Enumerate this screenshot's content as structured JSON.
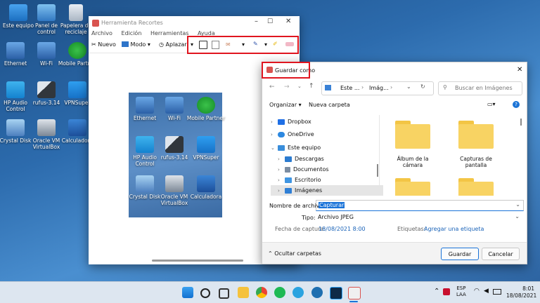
{
  "desktop": {
    "icons": [
      {
        "label": "Este equipo"
      },
      {
        "label": "Panel de control"
      },
      {
        "label": "Papelera de reciclaje"
      },
      {
        "label": "Ethernet"
      },
      {
        "label": "Wi-Fi"
      },
      {
        "label": "Mobile Partner"
      },
      {
        "label": "HP Audio Control"
      },
      {
        "label": "rufus-3.14"
      },
      {
        "label": "VPNSuper"
      },
      {
        "label": "Crystal Disk"
      },
      {
        "label": "Oracle VM VirtualBox"
      },
      {
        "label": "Calculadora"
      }
    ]
  },
  "snipping": {
    "title": "Herramienta Recortes",
    "menu": [
      "Archivo",
      "Edición",
      "Herramientas",
      "Ayuda"
    ],
    "toolbar": {
      "new": "Nuevo",
      "mode": "Modo",
      "delay": "Aplazar"
    },
    "capture_icons": [
      {
        "label": "Ethernet"
      },
      {
        "label": "Wi-Fi"
      },
      {
        "label": "Mobile Partner"
      },
      {
        "label": "HP Audio Control"
      },
      {
        "label": "rufus-3.14"
      },
      {
        "label": "VPNSuper"
      },
      {
        "label": "Crystal Disk"
      },
      {
        "label": "Oracle VM VirtualBox"
      },
      {
        "label": "Calculadora"
      }
    ]
  },
  "save_dialog": {
    "title": "Guardar como",
    "breadcrumb": [
      "Este ...",
      "Imág..."
    ],
    "search_placeholder": "Buscar en Imágenes",
    "organize": "Organizar",
    "new_folder": "Nueva carpeta",
    "tree": [
      "Dropbox",
      "OneDrive",
      "Este equipo",
      "Descargas",
      "Documentos",
      "Escritorio",
      "Imágenes"
    ],
    "folders": [
      {
        "label": "Álbum de la cámara"
      },
      {
        "label": "Capturas de pantalla"
      }
    ],
    "file_name_label": "Nombre de archivo:",
    "file_name_value": "Capturar",
    "type_label": "Tipo:",
    "type_value": "Archivo JPEG",
    "capture_date_label": "Fecha de captura:",
    "capture_date_value": "18/08/2021 8:00",
    "tags_label": "Etiquetas:",
    "tags_link": "Agregar una etiqueta",
    "hide_folders": "Ocultar carpetas",
    "save_button": "Guardar",
    "cancel_button": "Cancelar"
  },
  "taskbar": {
    "lang": "ESP",
    "region": "LAA",
    "time": "8:01",
    "date": "18/08/2021"
  }
}
